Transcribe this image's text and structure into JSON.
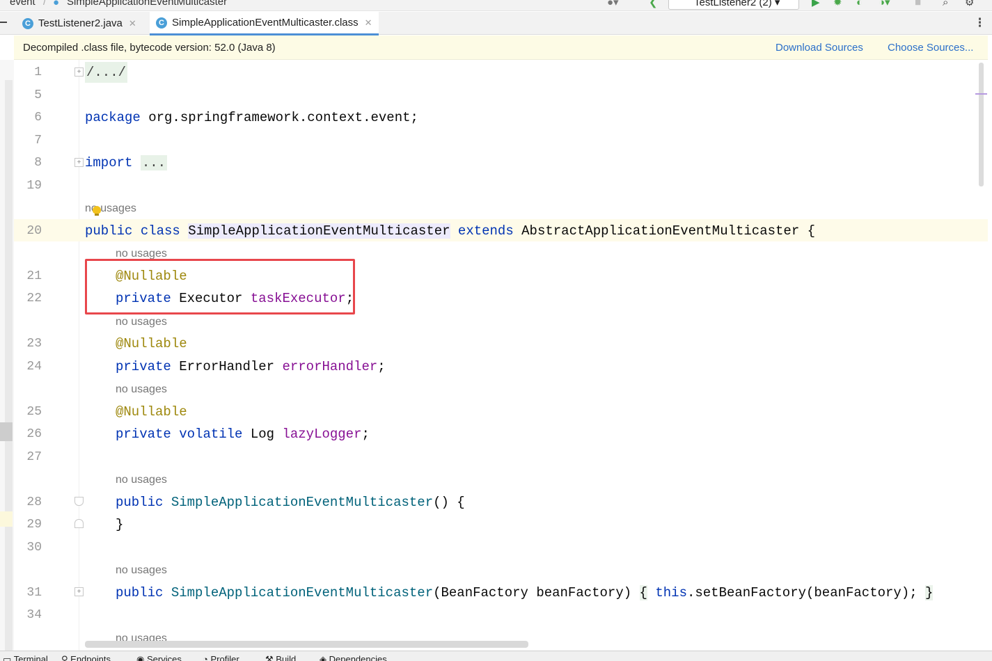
{
  "navbar": {
    "breadcrumb_parent": "event",
    "breadcrumb_current": "SimpleApplicationEventMulticaster",
    "run_config": "TestListener2 (2)"
  },
  "tabs": [
    {
      "label": "TestListener2.java",
      "icon": "java-class-icon",
      "active": false
    },
    {
      "label": "SimpleApplicationEventMulticaster.class",
      "icon": "java-class-icon",
      "active": true
    }
  ],
  "banner": {
    "message": "Decompiled .class file, bytecode version: 52.0 (Java 8)",
    "download_label": "Download Sources",
    "choose_label": "Choose Sources..."
  },
  "line_numbers": [
    "1",
    "5",
    "6",
    "7",
    "8",
    "19",
    "20",
    "21",
    "22",
    "23",
    "24",
    "25",
    "26",
    "27",
    "28",
    "29",
    "30",
    "31",
    "34"
  ],
  "code": {
    "folded_header": "/.../",
    "package_kw": "package",
    "package_name": " org.springframework.context.event;",
    "import_kw": "import",
    "import_fold": "...",
    "hint_no_usages": "no usages",
    "class_line": {
      "mod1": "public",
      "mod2": "class",
      "name": "SimpleApplicationEventMulticaster",
      "extends": "extends",
      "parent": " AbstractApplicationEventMulticaster {"
    },
    "annotation": "@Nullable",
    "field1": {
      "mod": "private",
      "type": " Executor ",
      "name": "taskExecutor",
      "end": ";"
    },
    "field2": {
      "mod": "private",
      "type": " ErrorHandler ",
      "name": "errorHandler",
      "end": ";"
    },
    "field3": {
      "mod": "private",
      "mod2": "volatile",
      "type": " Log ",
      "name": "lazyLogger",
      "end": ";"
    },
    "ctor1": {
      "mod": "public",
      "name": "SimpleApplicationEventMulticaster",
      "rest": "() {"
    },
    "closing_brace": "}",
    "ctor2": {
      "mod": "public",
      "name": "SimpleApplicationEventMulticaster",
      "params": "(BeanFactory beanFactory)",
      "open": "{",
      "this_kw": "this",
      "body": ".setBeanFactory(beanFactory);",
      "close": "}"
    }
  },
  "bottom_tools": [
    "Terminal",
    "Endpoints",
    "Services",
    "Profiler",
    "Build",
    "Dependencies"
  ],
  "colors": {
    "keyword": "#0033b3",
    "annotation": "#9e880d",
    "field": "#871094",
    "method": "#00627a",
    "highlight_box": "#e8474c",
    "link": "#2b6fc9"
  }
}
